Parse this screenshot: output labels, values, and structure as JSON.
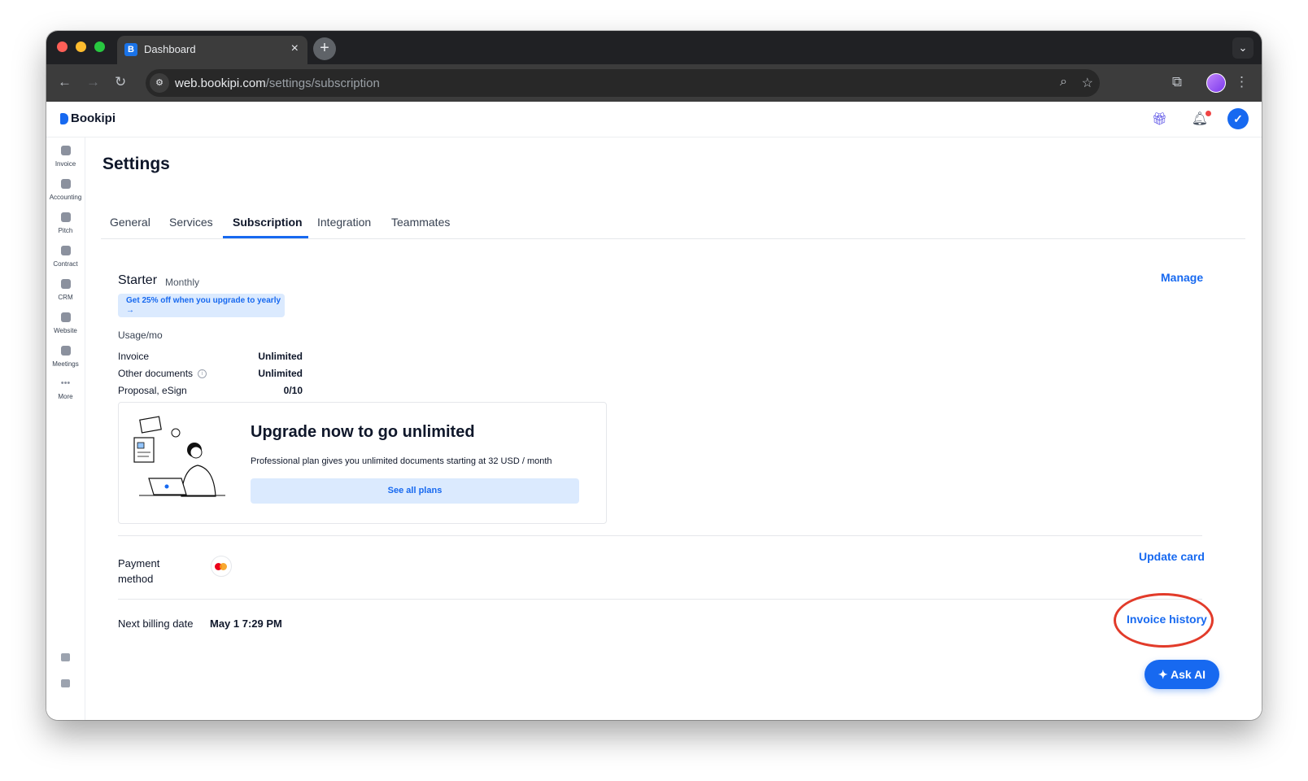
{
  "browser": {
    "tab_title": "Dashboard",
    "tab_close": "×",
    "new_tab": "+",
    "url_host": "web.bookipi.com",
    "url_path": "/settings/subscription"
  },
  "app": {
    "logo": "Bookipi",
    "sidebar": [
      {
        "label": "Invoice",
        "icon": "invoice-icon"
      },
      {
        "label": "Accounting",
        "icon": "accounting-icon"
      },
      {
        "label": "Pitch",
        "icon": "pitch-icon"
      },
      {
        "label": "Contract",
        "icon": "contract-icon"
      },
      {
        "label": "CRM",
        "icon": "crm-icon"
      },
      {
        "label": "Website",
        "icon": "website-icon"
      },
      {
        "label": "Meetings",
        "icon": "meetings-icon"
      },
      {
        "label": "More",
        "icon": "more-icon"
      }
    ]
  },
  "settings": {
    "title": "Settings",
    "tabs": [
      "General",
      "Services",
      "Subscription",
      "Integration",
      "Teammates"
    ],
    "active_tab": "Subscription"
  },
  "subscription": {
    "plan_name": "Starter",
    "billing_cycle": "Monthly",
    "manage_label": "Manage",
    "promo": "Get 25% off when you upgrade to yearly →",
    "usage_heading": "Usage/mo",
    "usage": [
      {
        "label": "Invoice",
        "value": "Unlimited"
      },
      {
        "label": "Other documents",
        "value": "Unlimited"
      },
      {
        "label": "Proposal, eSign",
        "value": "0/10"
      }
    ],
    "upgrade": {
      "title": "Upgrade now to go unlimited",
      "description": "Professional plan gives you unlimited documents starting at 32 USD / month",
      "button": "See all plans"
    },
    "payment_label": "Payment method",
    "update_card_label": "Update card",
    "next_billing_label": "Next billing date",
    "next_billing_value": "May 1 7:29 PM",
    "invoice_history_label": "Invoice history"
  },
  "ask_ai": "Ask AI",
  "colors": {
    "accent": "#1769f0",
    "highlight": "#e23b2a"
  }
}
